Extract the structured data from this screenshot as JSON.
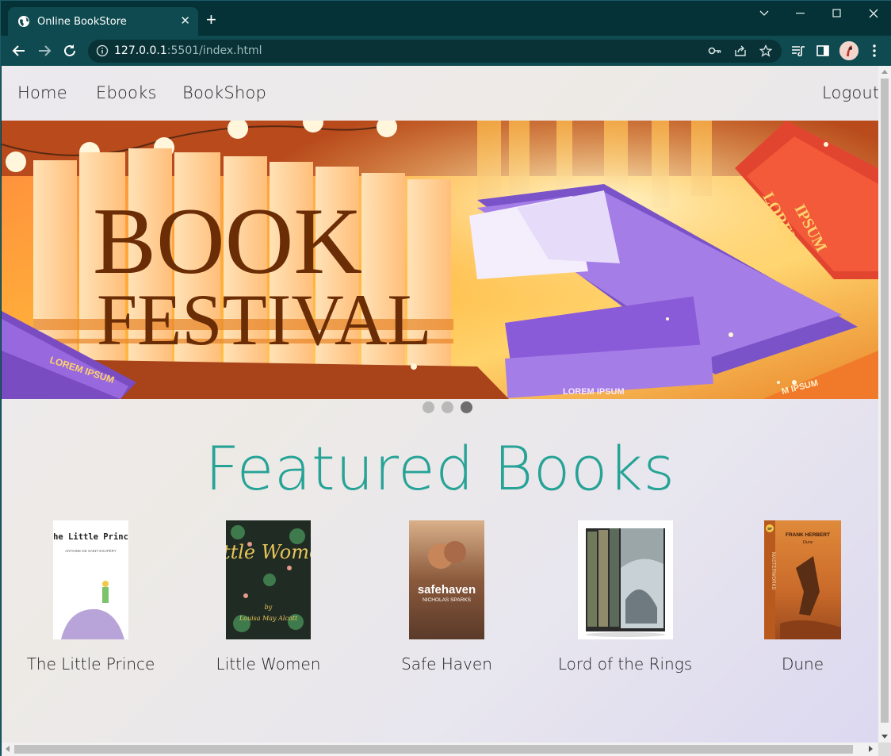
{
  "browser": {
    "tab_title": "Online BookStore",
    "tab_close": "✕",
    "new_tab": "+",
    "url_host": "127.0.0.1",
    "url_rest": ":5501/index.html"
  },
  "nav": {
    "home": "Home",
    "ebooks": "Ebooks",
    "bookshop": "BookShop",
    "logout": "Logout"
  },
  "banner": {
    "title_line1": "BOOK",
    "title_line2": "FESTIVAL",
    "spine_text_1": "LOREM",
    "spine_text_2": "IPSUM",
    "book_text_1": "LOREM IPSUM",
    "book_text_2": "IPSUM",
    "book_text_3": "LOREM IPSUM",
    "book_text_4": "M IPSUM",
    "carousel_active_index": 3,
    "carousel_count": 3
  },
  "featured": {
    "heading": "Featured Books",
    "books": [
      {
        "name": "The Little Prince",
        "cover_title": "The Little Prince",
        "cover_author": "ANTOINE DE SAINT-EXUPÉRY"
      },
      {
        "name": "Little Women",
        "cover_title": "Little Women",
        "cover_by": "by",
        "cover_author": "Louisa May Alcott"
      },
      {
        "name": "Safe Haven",
        "cover_title": "safehaven",
        "cover_author": "NICHOLAS SPARKS"
      },
      {
        "name": "Lord of the Rings",
        "cover_title": "",
        "cover_author": ""
      },
      {
        "name": "Dune",
        "cover_title": "Dune",
        "cover_author": "FRANK HERBERT",
        "cover_series": "MASTERWORKS",
        "cover_badge": "SF"
      }
    ]
  },
  "colors": {
    "heading": "#26a396",
    "browser_frame": "#053236",
    "toolbar": "#0e4a4f"
  }
}
